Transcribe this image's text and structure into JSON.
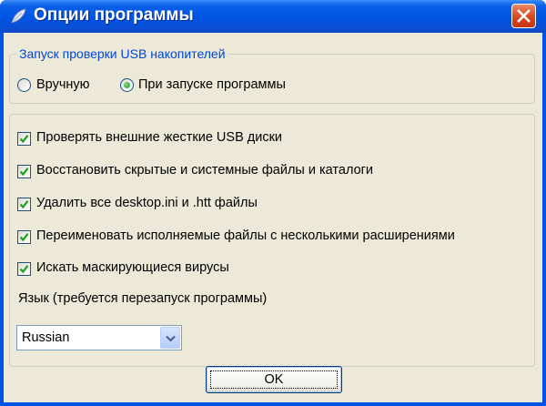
{
  "window": {
    "title": "Опции программы"
  },
  "usb_check_group": {
    "label": "Запуск проверки USB накопителей",
    "options": [
      {
        "label": "Вручную",
        "selected": false
      },
      {
        "label": "При запуске программы",
        "selected": true
      }
    ]
  },
  "options": [
    {
      "label": "Проверять внешние жесткие USB диски",
      "checked": true
    },
    {
      "label": "Восстановить скрытые и системные файлы и каталоги",
      "checked": true
    },
    {
      "label": "Удалить все desktop.ini и .htt файлы",
      "checked": true
    },
    {
      "label": "Переименовать исполняемые файлы с несколькими расширениями",
      "checked": true
    },
    {
      "label": "Искать маскирующиеся вирусы",
      "checked": true
    }
  ],
  "language": {
    "label": "Язык (требуется перезапуск программы)",
    "selected": "Russian"
  },
  "buttons": {
    "ok": "OK"
  },
  "colors": {
    "titlebar": "#0055e5",
    "group_label": "#0046d5",
    "check_mark": "#21a121",
    "close_button": "#d7471d"
  }
}
